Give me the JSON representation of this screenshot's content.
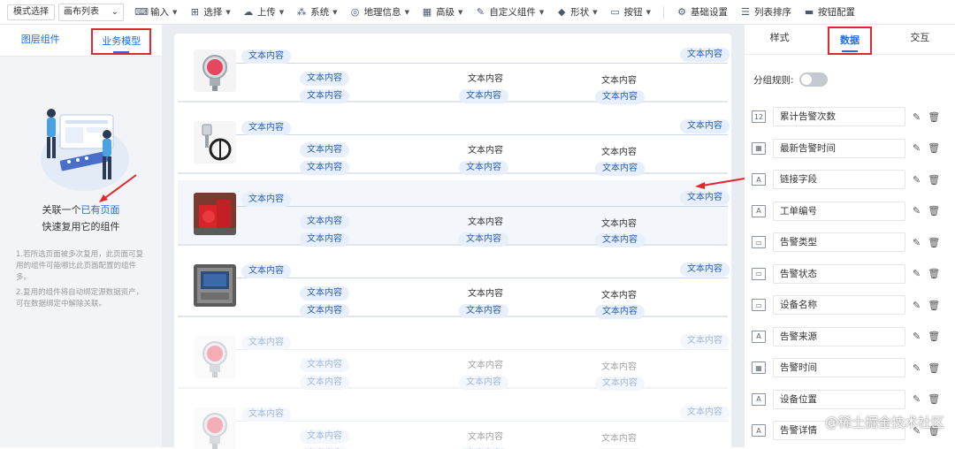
{
  "toolbar": {
    "mode_button": "模式选择",
    "canvas_select": "画布列表",
    "items": [
      {
        "label": "输入",
        "icon": "input-icon"
      },
      {
        "label": "选择",
        "icon": "select-icon"
      },
      {
        "label": "上传",
        "icon": "upload-icon"
      },
      {
        "label": "系统",
        "icon": "system-icon"
      },
      {
        "label": "地理信息",
        "icon": "geo-icon"
      },
      {
        "label": "高级",
        "icon": "advanced-icon"
      },
      {
        "label": "自定义组件",
        "icon": "custom-icon"
      },
      {
        "label": "形状",
        "icon": "shape-icon"
      },
      {
        "label": "按钮",
        "icon": "button-icon"
      }
    ],
    "right_items": [
      {
        "label": "基础设置",
        "icon": "settings-icon"
      },
      {
        "label": "列表排序",
        "icon": "sort-icon"
      },
      {
        "label": "按钮配置",
        "icon": "button-config-icon"
      }
    ]
  },
  "left_panel": {
    "tab_layers": "图层组件",
    "tab_business": "业务模型",
    "link_prefix": "关联一个",
    "link_text": "已有页面",
    "subtitle": "快速复用它的组件",
    "note1": "1.若所选页面被多次复用，此页面可复用的组件可能哪比此页面配置的组件多。",
    "note2": "2.复用的组件将自动绑定源数据资产，可在数据绑定中解除关联。"
  },
  "list": {
    "pill_text": "文本内容",
    "plain_text": "文本内容",
    "rows": [
      {
        "image": "pressure-gauge",
        "highlight": false,
        "faded": false
      },
      {
        "image": "level-sensor",
        "highlight": false,
        "faded": false
      },
      {
        "image": "fire-pump",
        "highlight": true,
        "faded": false
      },
      {
        "image": "control-cabinet",
        "highlight": false,
        "faded": false
      },
      {
        "image": "pressure-gauge",
        "highlight": false,
        "faded": true
      },
      {
        "image": "pressure-gauge",
        "highlight": false,
        "faded": true
      }
    ]
  },
  "right_panel": {
    "tabs": [
      "样式",
      "数据",
      "交互"
    ],
    "group_rule": "分组规则:",
    "fields": [
      {
        "label": "累计告警次数",
        "icon": "123"
      },
      {
        "label": "最新告警时间",
        "icon": "cal"
      },
      {
        "label": "链接字段",
        "icon": "A"
      },
      {
        "label": "工单编号",
        "icon": "A"
      },
      {
        "label": "告警类型",
        "icon": "sel"
      },
      {
        "label": "告警状态",
        "icon": "sel"
      },
      {
        "label": "设备名称",
        "icon": "sel"
      },
      {
        "label": "告警来源",
        "icon": "A"
      },
      {
        "label": "告警时间",
        "icon": "cal"
      },
      {
        "label": "设备位置",
        "icon": "A"
      },
      {
        "label": "告警详情",
        "icon": "txt"
      }
    ]
  },
  "watermark": "@稀土掘金技术社区",
  "colors": {
    "accent": "#1e6fe0",
    "annotation": "#e0282e",
    "pill_bg": "#e6effb"
  }
}
